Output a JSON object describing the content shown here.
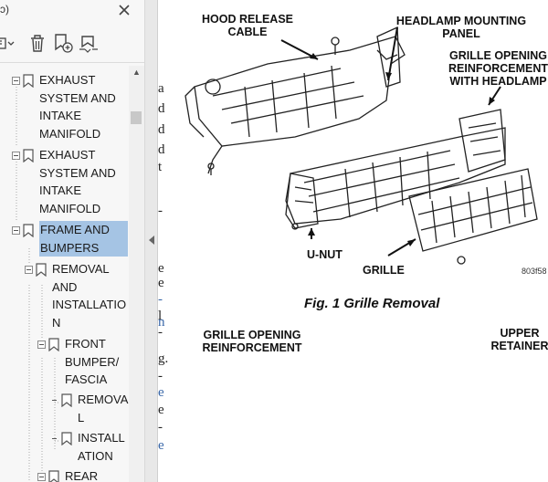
{
  "panel": {
    "title": "ѕɔ)",
    "bookmarks": [
      {
        "label": "EXHAUST SYSTEM AND INTAKE MANIFOLD"
      },
      {
        "label": "EXHAUST SYSTEM AND INTAKE MANIFOLD"
      },
      {
        "label": "FRAME AND BUMPERS"
      },
      {
        "label": "REMOVAL AND INSTALLATIO N"
      },
      {
        "label": "FRONT BUMPER/ FASCIA"
      },
      {
        "label": "REMOVA L"
      },
      {
        "label": "INSTALL ATION"
      },
      {
        "label": "REAR"
      }
    ],
    "icons": {
      "close": "close-icon",
      "options": "options-menu-icon",
      "delete": "trash-icon",
      "new_bookmark": "add-bookmark-icon",
      "expand": "expand-bookmark-icon",
      "bookmark": "bookmark-icon"
    }
  },
  "page": {
    "fragments": [
      "a",
      "d",
      "d",
      "d",
      "t",
      "-",
      "e",
      "e",
      "-",
      "l",
      "n",
      "-",
      "g.",
      "-",
      "e",
      "e",
      "-",
      "e"
    ],
    "figure1": {
      "callouts": [
        "HOOD RELEASE CABLE",
        "HEADLAMP MOUNTING PANEL",
        "GRILLE OPENING REINFORCEMENT WITH HEADLAMP",
        "U-NUT",
        "GRILLE"
      ],
      "code": "803f58",
      "caption": "Fig. 1 Grille Removal"
    },
    "figure2": {
      "callouts": [
        "GRILLE OPENING REINFORCEMENT",
        "UPPER RETAINER"
      ]
    }
  },
  "colors": {
    "selection": "#a5c4e4",
    "link_blue": "#3866a8"
  }
}
